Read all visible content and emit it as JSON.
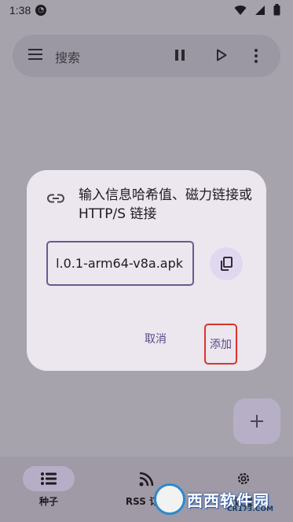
{
  "status_bar": {
    "time": "1:38"
  },
  "search": {
    "placeholder": "搜索"
  },
  "dialog": {
    "title": "输入信息哈希值、磁力链接或 HTTP/S 链接",
    "input_value": "l.0.1-arm64-v8a.apk",
    "cancel_label": "取消",
    "add_label": "添加"
  },
  "bottom_nav": {
    "items": [
      {
        "label": "种子",
        "active": true
      },
      {
        "label": "RSS 订阅",
        "active": false
      },
      {
        "label": "设置",
        "active": false
      }
    ]
  },
  "watermark": {
    "text": "西西软件园",
    "url": "CR173.COM"
  },
  "colors": {
    "accent": "#5a4a86",
    "highlight_border": "#d9342a"
  }
}
